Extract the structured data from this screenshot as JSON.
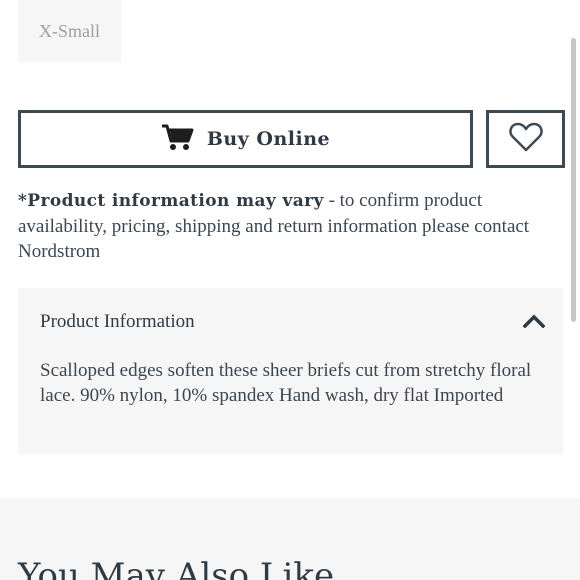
{
  "size_option": {
    "label": "X-Small"
  },
  "actions": {
    "buy_label": "Buy Online",
    "cart_icon": "cart-icon",
    "favorite_icon": "heart-icon"
  },
  "disclaimer": {
    "bold": "*Product information may vary",
    "text": " - to confirm product availability, pricing, shipping and return information please contact Nordstrom"
  },
  "product_info": {
    "title": "Product Information",
    "toggle_icon": "chevron-up-icon",
    "body": "Scalloped edges soften these sheer briefs cut from stretchy floral lace. 90% nylon, 10% spandex Hand wash, dry flat Imported"
  },
  "recommendations": {
    "heading": "You May Also Like"
  },
  "colors": {
    "text": "#2e3a44",
    "panel": "#f6f6f6",
    "border": "#3b4a54"
  }
}
